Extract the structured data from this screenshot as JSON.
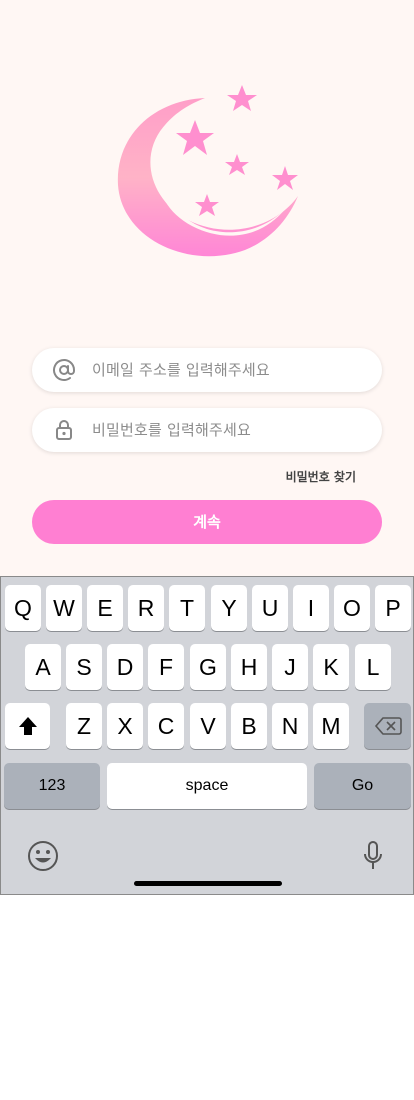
{
  "colors": {
    "accent": "#ff7fd2",
    "background": "#fff7f4"
  },
  "login": {
    "email_placeholder": "이메일 주소를 입력해주세요",
    "password_placeholder": "비밀번호를 입력해주세요",
    "find_password": "비밀번호 찾기",
    "continue_label": "계속"
  },
  "keyboard": {
    "row1": [
      "Q",
      "W",
      "E",
      "R",
      "T",
      "Y",
      "U",
      "I",
      "O",
      "P"
    ],
    "row2": [
      "A",
      "S",
      "D",
      "F",
      "G",
      "H",
      "J",
      "K",
      "L"
    ],
    "row3": [
      "Z",
      "X",
      "C",
      "V",
      "B",
      "N",
      "M"
    ],
    "numbers_label": "123",
    "space_label": "space",
    "go_label": "Go"
  }
}
